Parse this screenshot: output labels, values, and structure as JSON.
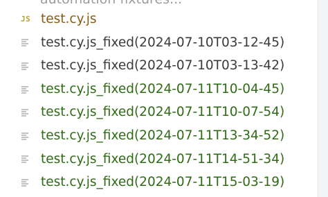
{
  "cutoff_label": "automation fixtures...",
  "files": [
    {
      "name": "test.cy.js",
      "icon": "js-file-icon",
      "icon_text": "JS",
      "status": "modified",
      "color": "#8a5a14"
    },
    {
      "name": "test.cy.js_fixed(2024-07-10T03-12-45)",
      "icon": "text-file-icon",
      "status": "unchanged",
      "color": "#3a3a3a"
    },
    {
      "name": "test.cy.js_fixed(2024-07-10T03-13-42)",
      "icon": "text-file-icon",
      "status": "unchanged",
      "color": "#3a3a3a"
    },
    {
      "name": "test.cy.js_fixed(2024-07-11T10-04-45)",
      "icon": "text-file-icon",
      "status": "added",
      "color": "#2e6b14"
    },
    {
      "name": "test.cy.js_fixed(2024-07-11T10-07-54)",
      "icon": "text-file-icon",
      "status": "added",
      "color": "#2e6b14"
    },
    {
      "name": "test.cy.js_fixed(2024-07-11T13-34-52)",
      "icon": "text-file-icon",
      "status": "added",
      "color": "#2e6b14"
    },
    {
      "name": "test.cy.js_fixed(2024-07-11T14-51-34)",
      "icon": "text-file-icon",
      "status": "added",
      "color": "#2e6b14"
    },
    {
      "name": "test.cy.js_fixed(2024-07-11T15-03-19)",
      "icon": "text-file-icon",
      "status": "added",
      "color": "#2e6b14"
    }
  ]
}
